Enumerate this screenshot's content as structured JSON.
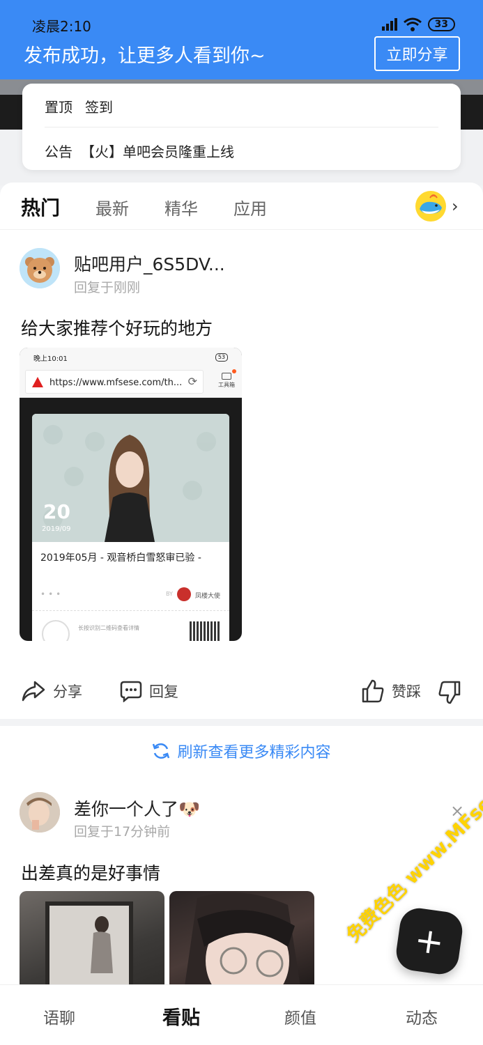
{
  "status_bar": {
    "time": "凌晨2:10",
    "battery": "33"
  },
  "banner": {
    "message": "发布成功，让更多人看到你~",
    "share_button": "立即分享"
  },
  "notice": {
    "pin_label": "置顶",
    "checkin_label": "签到",
    "announcement_label": "公告",
    "announcement_text": "【火】单吧会员隆重上线"
  },
  "tabs": [
    {
      "label": "热门"
    },
    {
      "label": "最新"
    },
    {
      "label": "精华"
    },
    {
      "label": "应用"
    }
  ],
  "post1": {
    "username": "贴吧用户_6S5DV...",
    "meta": "回复于刚刚",
    "title": "给大家推荐个好玩的地方",
    "shot": {
      "time": "晚上10:01",
      "battery": "53",
      "url": "https://www.mfsese.com/th...",
      "toolbox": "工具箱",
      "date_day": "20",
      "date_sub": "2019/09",
      "caption": "2019年05月 - 观音桥白雪怒审已验 -",
      "by": "BY",
      "author": "凤楼大使",
      "footer": "长按识别二维码查看详情"
    },
    "actions": {
      "share": "分享",
      "reply": "回复",
      "like": "赞踩"
    }
  },
  "refresh_text": "刷新查看更多精彩内容",
  "post2": {
    "username": "差你一个人了🐶",
    "meta": "回复于17分钟前",
    "title": "出差真的是好事情"
  },
  "fab_label": "+",
  "bottom_nav": [
    {
      "label": "语聊"
    },
    {
      "label": "看贴"
    },
    {
      "label": "颜值"
    },
    {
      "label": "动态"
    }
  ],
  "watermark": "免费色色 www.MFsese.com",
  "colors": {
    "accent": "#3a8af5",
    "banner": "#3a8af5"
  }
}
